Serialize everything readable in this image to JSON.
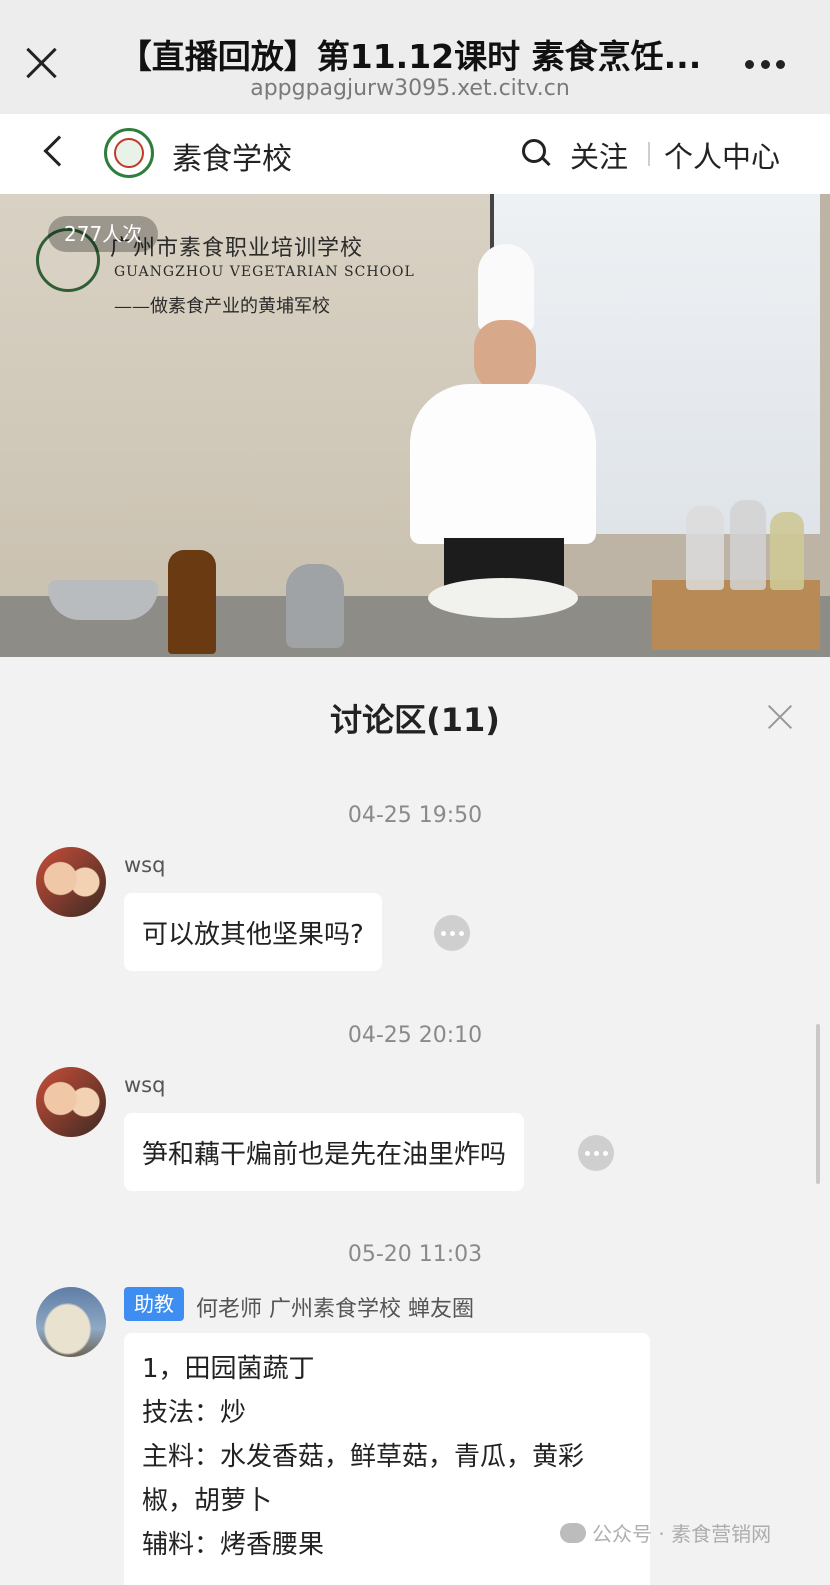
{
  "browser": {
    "title": "【直播回放】第11.12课时 素食烹饪...",
    "url": "appgpagjurw3095.xet.citv.cn"
  },
  "account": {
    "name": "素食学校",
    "follow_label": "关注",
    "profile_label": "个人中心"
  },
  "video": {
    "view_count": "277人次",
    "banner_cn": "广州市素食职业培训学校",
    "banner_en": "GUANGZHOU VEGETARIAN SCHOOL",
    "banner_slogan": "——做素食产业的黄埔军校"
  },
  "discussion": {
    "title": "讨论区(11)",
    "messages": [
      {
        "time": "04-25 19:50",
        "user": "wsq",
        "text": "可以放其他坚果吗?"
      },
      {
        "time": "04-25 20:10",
        "user": "wsq",
        "text": "笋和藕干煸前也是先在油里炸吗"
      },
      {
        "time": "05-20 11:03",
        "role": "助教",
        "user": "何老师 广州素食学校 蝉友圈",
        "lines": [
          "1，田园菌蔬丁",
          "技法：炒",
          "主料：水发香菇，鲜草菇，青瓜，黄彩椒，胡萝卜",
          "辅料：烤香腰果"
        ]
      }
    ]
  },
  "watermark": "公众号 · 素食营销网"
}
